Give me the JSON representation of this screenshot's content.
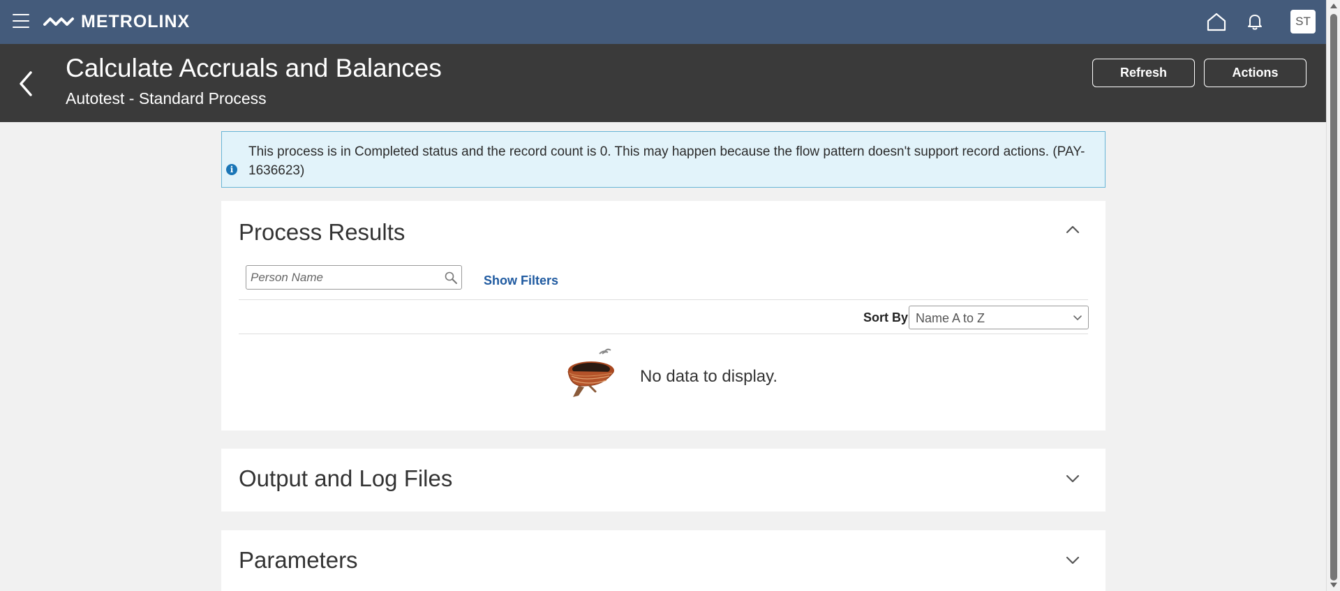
{
  "topbar": {
    "brand": "METROLINX",
    "menu_icon": "hamburger-menu-icon",
    "home_icon": "home-icon",
    "notifications_icon": "bell-icon",
    "user_initials": "ST",
    "background_color": "#445b7b"
  },
  "header": {
    "title": "Calculate Accruals and Balances",
    "subtitle": "Autotest - Standard Process",
    "back_icon": "chevron-left-icon",
    "refresh_label": "Refresh",
    "actions_label": "Actions",
    "background_color": "#3a3a3a"
  },
  "info_banner": {
    "icon": "info-icon",
    "message": "This process is in Completed status and the record count is 0. This may happen because the flow pattern doesn't support record actions. (PAY-1636623)"
  },
  "process_results": {
    "title": "Process Results",
    "expanded": true,
    "search": {
      "placeholder": "Person Name",
      "value": ""
    },
    "show_filters_label": "Show Filters",
    "sort_by_label": "Sort By",
    "sort_by_value": "Name A to Z",
    "empty_message": "No data to display."
  },
  "sections": {
    "output_title": "Output and Log Files",
    "parameters_title": "Parameters"
  }
}
